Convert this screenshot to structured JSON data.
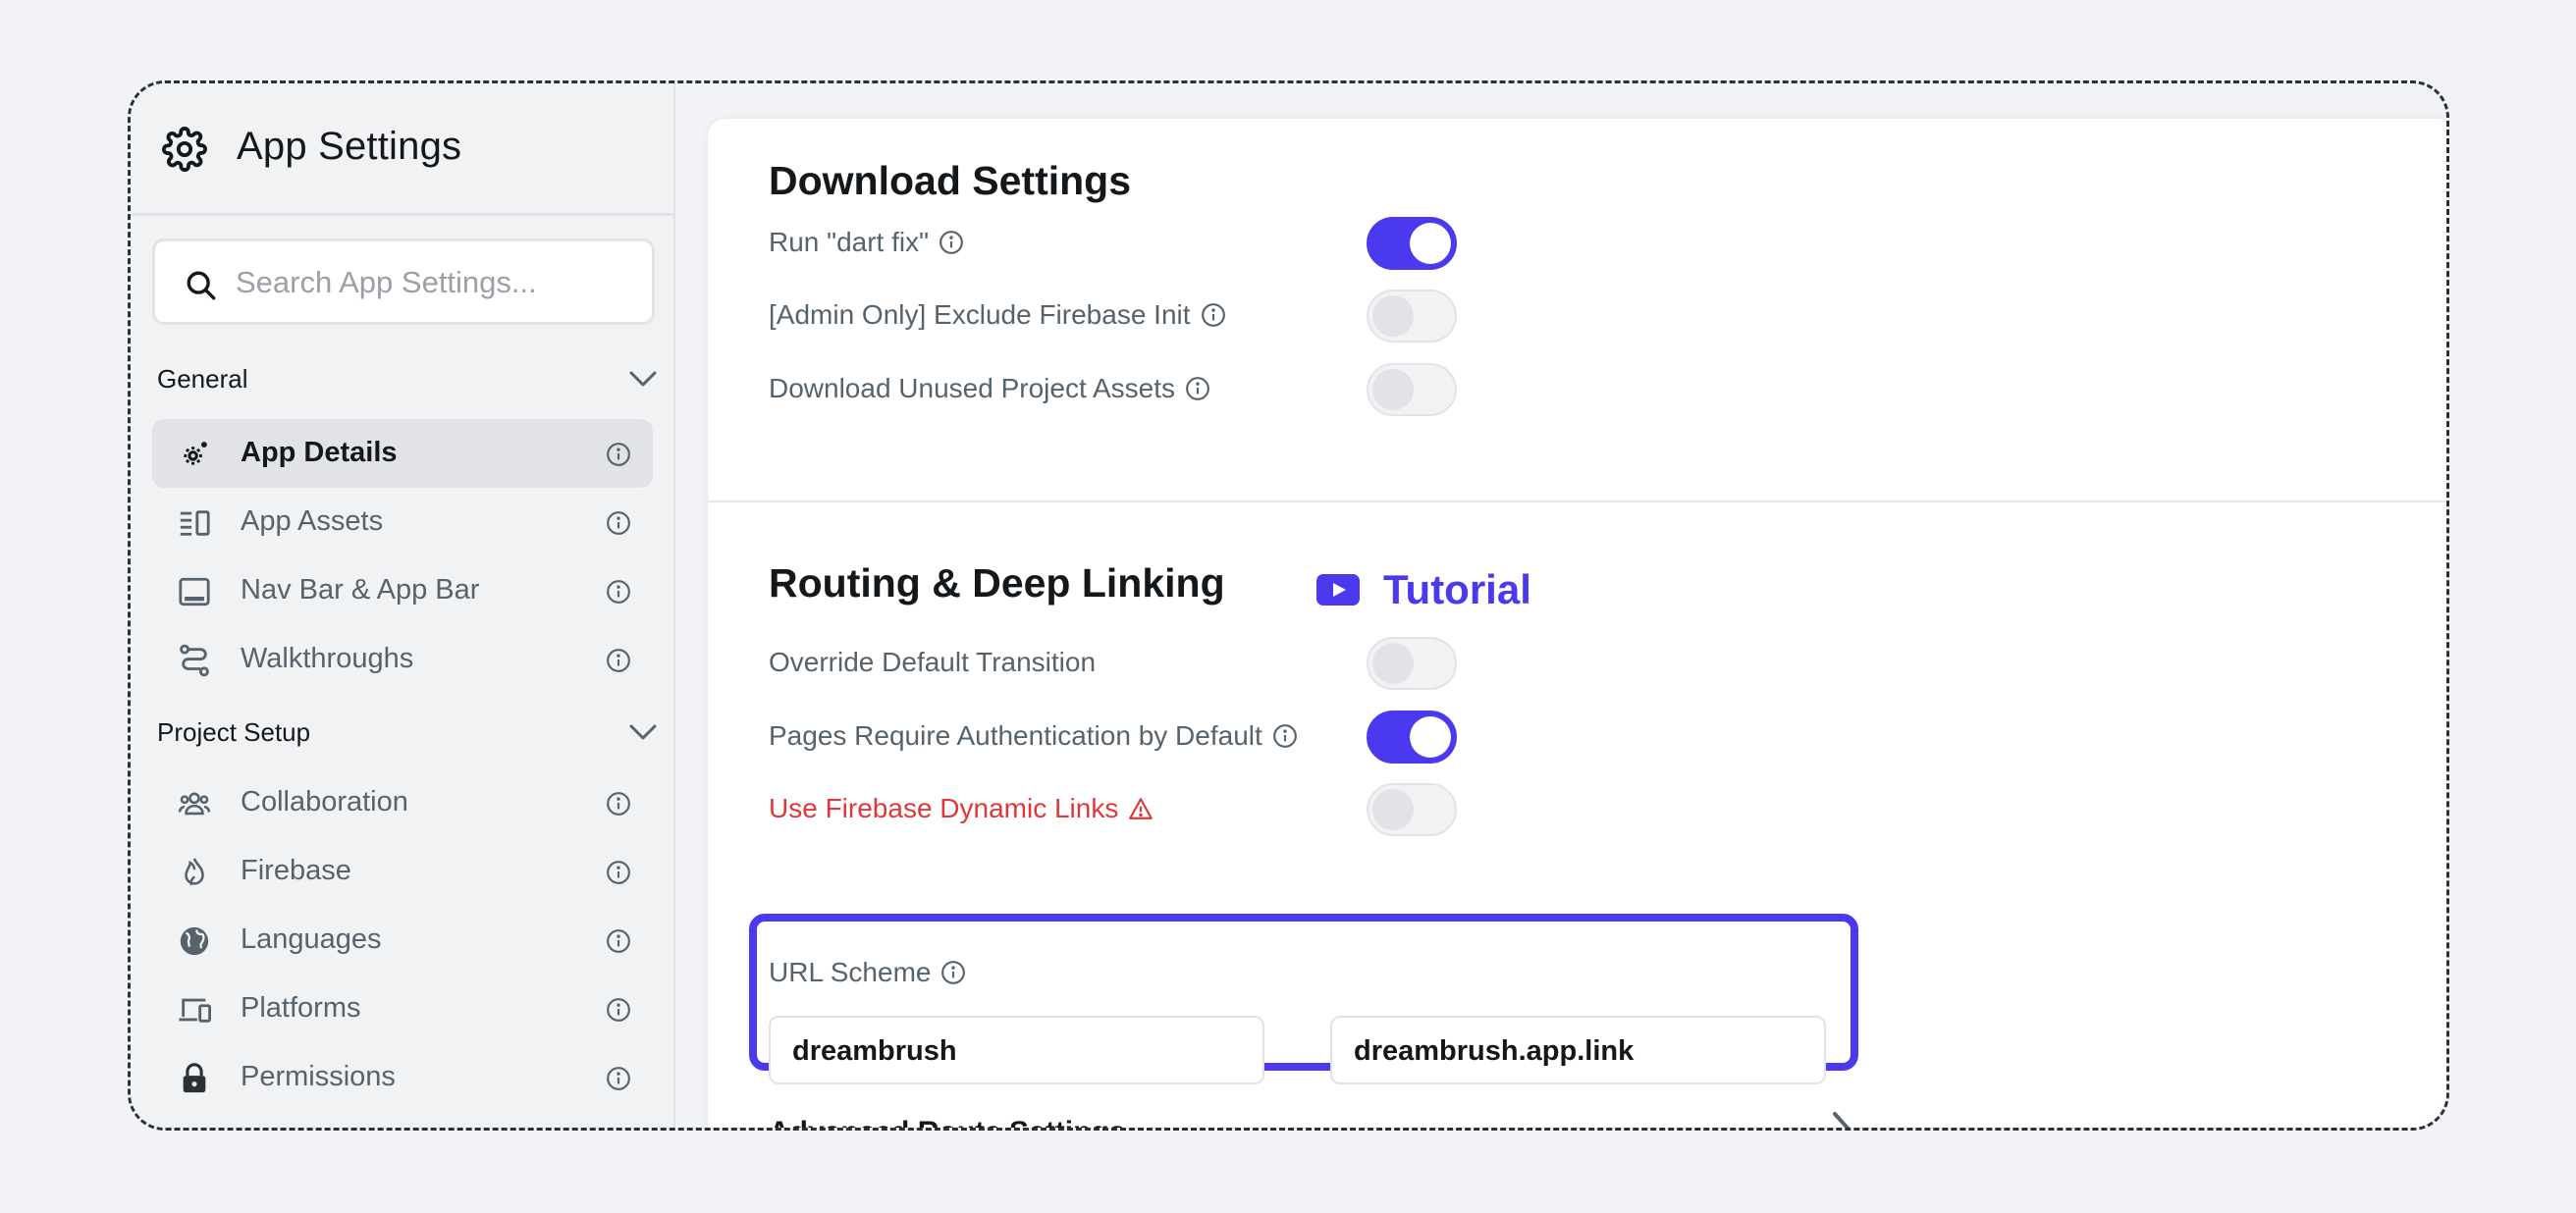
{
  "sidebar": {
    "title": "App Settings",
    "search_placeholder": "Search App Settings...",
    "sections": [
      {
        "title": "General",
        "items": [
          {
            "label": "App Details",
            "icon": "app-details-gear-icon",
            "active": true
          },
          {
            "label": "App Assets",
            "icon": "app-assets-icon"
          },
          {
            "label": "Nav Bar & App Bar",
            "icon": "nav-bar-icon"
          },
          {
            "label": "Walkthroughs",
            "icon": "walkthrough-icon"
          }
        ]
      },
      {
        "title": "Project Setup",
        "items": [
          {
            "label": "Collaboration",
            "icon": "collaboration-icon"
          },
          {
            "label": "Firebase",
            "icon": "firebase-flame-icon"
          },
          {
            "label": "Languages",
            "icon": "globe-icon"
          },
          {
            "label": "Platforms",
            "icon": "devices-icon"
          },
          {
            "label": "Permissions",
            "icon": "lock-icon"
          }
        ]
      }
    ]
  },
  "download": {
    "title": "Download Settings",
    "options": [
      {
        "label": "Run \"dart fix\"",
        "on": true
      },
      {
        "label": "[Admin Only] Exclude Firebase Init",
        "on": false
      },
      {
        "label": "Download Unused Project Assets",
        "on": false
      }
    ]
  },
  "routing": {
    "title": "Routing & Deep Linking",
    "tutorial_label": "Tutorial",
    "options": [
      {
        "label": "Override Default Transition",
        "on": false
      },
      {
        "label": "Pages Require Authentication by Default",
        "on": true
      },
      {
        "label": "Use Firebase Dynamic Links",
        "on": false,
        "warning": true
      }
    ],
    "url_scheme_label": "URL Scheme",
    "url_scheme_value": "dreambrush",
    "url_host_value": "dreambrush.app.link",
    "advanced_label": "Advanced Route Settings"
  },
  "colors": {
    "accent": "#4b39ef",
    "danger": "#e0383a",
    "highlight_border": "#4b39ef"
  }
}
